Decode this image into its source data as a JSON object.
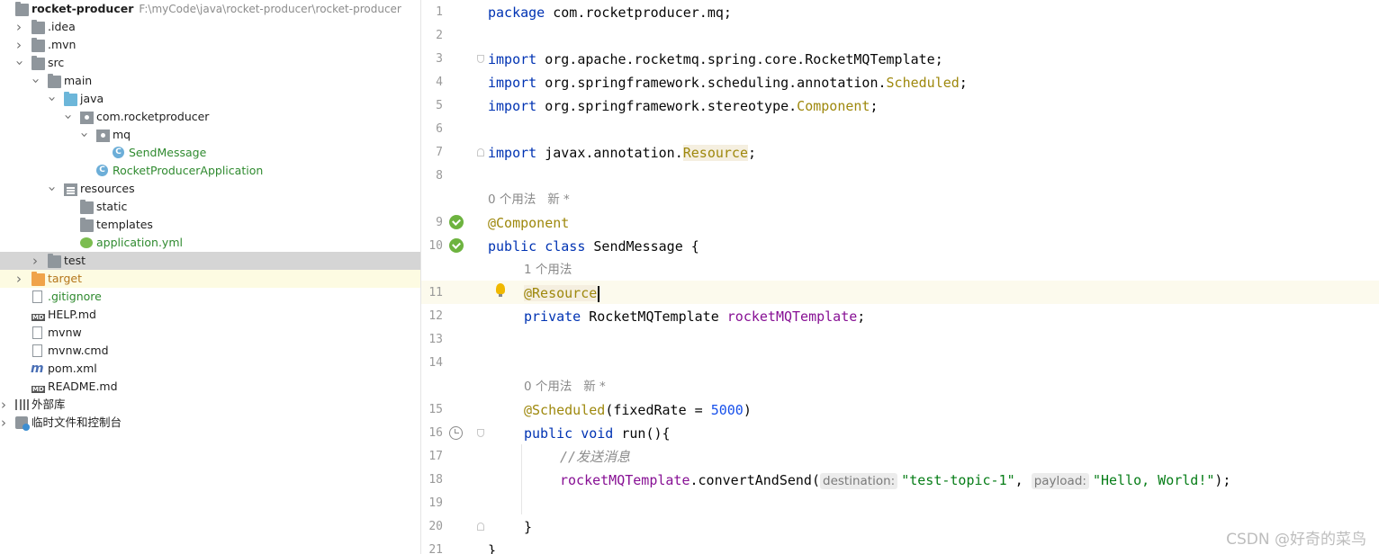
{
  "tree": {
    "root": {
      "name": "rocket-producer",
      "path": "F:\\myCode\\java\\rocket-producer\\rocket-producer"
    },
    "items": [
      {
        "label": "rocket-producer"
      },
      {
        "label": ".idea"
      },
      {
        "label": ".mvn"
      },
      {
        "label": "src"
      },
      {
        "label": "main"
      },
      {
        "label": "java"
      },
      {
        "label": "com.rocketproducer"
      },
      {
        "label": "mq"
      },
      {
        "label": "SendMessage"
      },
      {
        "label": "RocketProducerApplication"
      },
      {
        "label": "resources"
      },
      {
        "label": "static"
      },
      {
        "label": "templates"
      },
      {
        "label": "application.yml"
      },
      {
        "label": "test"
      },
      {
        "label": "target"
      },
      {
        "label": ".gitignore"
      },
      {
        "label": "HELP.md"
      },
      {
        "label": "mvnw"
      },
      {
        "label": "mvnw.cmd"
      },
      {
        "label": "pom.xml"
      },
      {
        "label": "README.md"
      },
      {
        "label": "外部库"
      },
      {
        "label": "临时文件和控制台"
      }
    ]
  },
  "editor": {
    "line_numbers": [
      "1",
      "2",
      "3",
      "4",
      "5",
      "6",
      "7",
      "8",
      "9",
      "10",
      "11",
      "12",
      "13",
      "14",
      "15",
      "16",
      "17",
      "18",
      "19",
      "20",
      "21"
    ],
    "code": {
      "l1_kw": "package",
      "l1_rest": " com.rocketproducer.mq;",
      "import_kw": "import",
      "l3_rest": " org.apache.rocketmq.spring.core.RocketMQTemplate;",
      "l4_pre": " org.springframework.scheduling.annotation.",
      "l4_cls": "Scheduled",
      "l4_end": ";",
      "l5_pre": " org.springframework.stereotype.",
      "l5_cls": "Component",
      "l5_end": ";",
      "l7_pre": " javax.annotation.",
      "l7_cls": "Resource",
      "l7_end": ";",
      "hint_usage_0": "0 个用法   新 *",
      "l9_ann": "@Component",
      "l10_kw": "public class",
      "l10_rest": " SendMessage {",
      "hint_usage_1": "1 个用法",
      "l11_ann": "@Resource",
      "l12_kw": "private",
      "l12_type": " RocketMQTemplate ",
      "l12_field": "rocketMQTemplate",
      "l12_end": ";",
      "hint_usage_2": "0 个用法   新 *",
      "l15_ann": "@Scheduled",
      "l15_mid": "(fixedRate = ",
      "l15_num": "5000",
      "l15_end": ")",
      "l16_kw": "public void",
      "l16_rest": " run(){",
      "l17_comment": "//发送消息",
      "l18_field": "rocketMQTemplate",
      "l18_call": ".convertAndSend(",
      "l18_hint1": "destination:",
      "l18_str1": "\"test-topic-1\"",
      "l18_comma": ", ",
      "l18_hint2": "payload:",
      "l18_str2": "\"Hello, World!\"",
      "l18_end": ");",
      "l20_close": "}",
      "l21_close": "}"
    }
  },
  "watermark": "CSDN @好奇的菜鸟"
}
